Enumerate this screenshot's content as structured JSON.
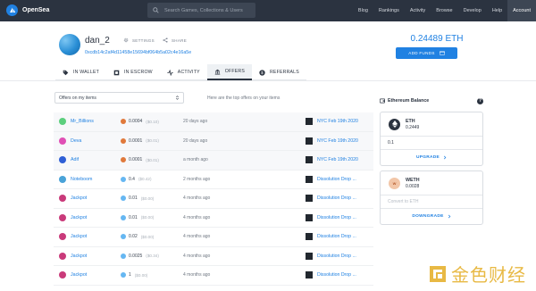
{
  "header": {
    "app_name": "OpenSea",
    "search_placeholder": "Search Games, Collections & Users",
    "nav": [
      "Blog",
      "Rankings",
      "Activity",
      "Browse",
      "Develop",
      "Help",
      "Account"
    ],
    "active_nav": "Account"
  },
  "profile": {
    "username": "dan_2",
    "settings_label": "SETTINGS",
    "share_label": "SHARE",
    "address": "0xcdb14c2af4d11458e15694bf064b5a02c4e16a5e",
    "eth_balance": "0.24489 ETH",
    "add_funds_label": "ADD FUNDS"
  },
  "tabs": [
    {
      "label": "IN WALLET",
      "icon": "tag-icon"
    },
    {
      "label": "IN ESCROW",
      "icon": "escrow-icon"
    },
    {
      "label": "ACTIVITY",
      "icon": "activity-icon"
    },
    {
      "label": "OFFERS",
      "icon": "offers-icon"
    },
    {
      "label": "REFERRALS",
      "icon": "dollar-icon"
    }
  ],
  "active_tab": "OFFERS",
  "filter": {
    "selected": "Offers on my items",
    "helper": "Here are the top offers on your items"
  },
  "offers": [
    {
      "user": "Mr_Billions",
      "color": "#5ccf7d",
      "coin": "weth",
      "amount": "0.0004",
      "usd": "($0.10)",
      "time": "20 days ago",
      "item": "NYC Feb 19th 2020",
      "shaded": true
    },
    {
      "user": "Deva",
      "color": "#e04fb5",
      "coin": "weth",
      "amount": "0.0001",
      "usd": "($0.01)",
      "time": "20 days ago",
      "item": "NYC Feb 19th 2020",
      "shaded": true
    },
    {
      "user": "Adif",
      "color": "#2f5fd6",
      "coin": "weth",
      "amount": "0.0001",
      "usd": "($0.01)",
      "time": "a month ago",
      "item": "NYC Feb 19th 2020",
      "shaded": true
    },
    {
      "user": "Noteboom",
      "color": "#4aa3d8",
      "coin": "eth",
      "amount": "0.4",
      "usd": "($0.42)",
      "time": "2 months ago",
      "item": "Dissolution Drop ...",
      "shaded": false
    },
    {
      "user": "Jackpot",
      "color": "#c93a7a",
      "coin": "eth",
      "amount": "0.01",
      "usd": "($0.00)",
      "time": "4 months ago",
      "item": "Dissolution Drop ...",
      "shaded": false
    },
    {
      "user": "Jackpot",
      "color": "#c93a7a",
      "coin": "eth",
      "amount": "0.01",
      "usd": "($0.00)",
      "time": "4 months ago",
      "item": "Dissolution Drop ...",
      "shaded": false
    },
    {
      "user": "Jackpot",
      "color": "#c93a7a",
      "coin": "eth",
      "amount": "0.02",
      "usd": "($0.00)",
      "time": "4 months ago",
      "item": "Dissolution Drop ...",
      "shaded": false
    },
    {
      "user": "Jackpot",
      "color": "#c93a7a",
      "coin": "eth",
      "amount": "0.0025",
      "usd": "($0.34)",
      "time": "4 months ago",
      "item": "Dissolution Drop ...",
      "shaded": false
    },
    {
      "user": "Jackpot",
      "color": "#c93a7a",
      "coin": "eth",
      "amount": "1",
      "usd": "($0.00)",
      "time": "4 months ago",
      "item": "Dissolution Drop ...",
      "shaded": false
    }
  ],
  "wallet_panel": {
    "title": "Ethereum Balance",
    "help": "?",
    "eth": {
      "symbol": "ETH",
      "balance": "0.2449",
      "input_value": "0.1",
      "action": "UPGRADE"
    },
    "weth": {
      "symbol": "WETH",
      "icon_text": "W",
      "balance": "0.0028",
      "placeholder": "Convert to ETH",
      "action": "DOWNGRADE"
    }
  },
  "watermark": {
    "text": "金色财经"
  },
  "colors": {
    "topbar": "#2b3340",
    "accent": "#2081e2"
  }
}
